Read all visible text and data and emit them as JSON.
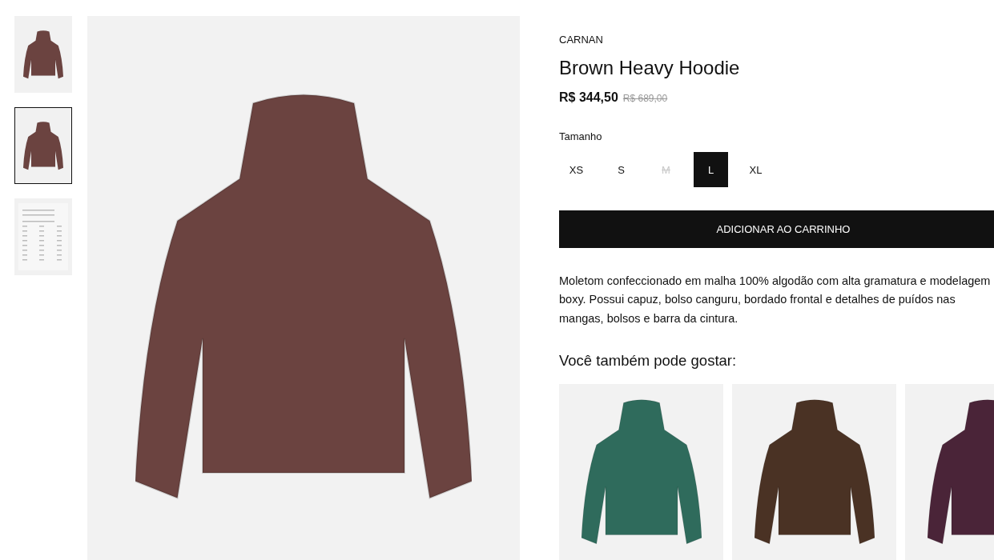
{
  "gallery": {
    "thumbnails": [
      {
        "kind": "hoodie-front",
        "selected": false
      },
      {
        "kind": "hoodie-back",
        "selected": true
      },
      {
        "kind": "size-chart",
        "selected": false
      }
    ]
  },
  "product": {
    "brand": "CARNAN",
    "title": "Brown Heavy Hoodie",
    "price": "R$ 344,50",
    "old_price": "R$ 689,00",
    "size_label": "Tamanho",
    "sizes": [
      {
        "label": "XS",
        "selected": false,
        "disabled": false
      },
      {
        "label": "S",
        "selected": false,
        "disabled": false
      },
      {
        "label": "M",
        "selected": false,
        "disabled": true
      },
      {
        "label": "L",
        "selected": true,
        "disabled": false
      },
      {
        "label": "XL",
        "selected": false,
        "disabled": false
      }
    ],
    "add_to_cart": "ADICIONAR AO CARRINHO",
    "description": "Moletom confeccionado em malha 100% algodão com alta gramatura e modelagem boxy. Possui capuz, bolso canguru, bordado frontal e detalhes de puídos nas mangas, bolsos e barra da cintura."
  },
  "recommendations": {
    "title": "Você também pode gostar:",
    "items": [
      {
        "color": "#2f6b5c"
      },
      {
        "color": "#4a3224"
      },
      {
        "color": "#4a2438"
      }
    ]
  }
}
